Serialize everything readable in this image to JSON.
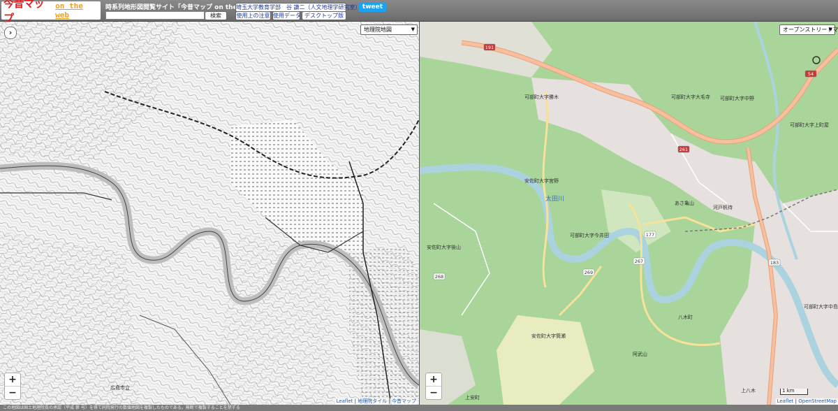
{
  "header": {
    "logo_main": "今昔マップ",
    "logo_sub": "on the web",
    "site_title": "時系列地形図閲覧サイト「今昔マップ on the web」",
    "search_placeholder": "",
    "search_button": "検索",
    "affiliation_link": "埼玉大学教育学部　谷 謙二（人文地理学研究室）",
    "usage_notes_link": "使用上の注意",
    "data_used_link": "使用データ",
    "desktop_link": "デスクトップ版",
    "tweet_label": "tweet"
  },
  "left_map": {
    "sidebar_toggle": "›",
    "map_select": "地理院地図",
    "zoom_in": "+",
    "zoom_out": "−",
    "attribution_leaflet": "Leaflet",
    "attribution_tiles": "地理院タイル",
    "attribution_site": "今昔マップ",
    "labels": [
      "広島市立"
    ]
  },
  "right_map": {
    "map_select": "オープンストリートマップ",
    "zoom_in": "+",
    "zoom_out": "−",
    "scale_label": "1 km",
    "attribution_leaflet": "Leaflet",
    "attribution_osm": "OpenStreetMap",
    "place_labels": [
      "可部町大字勝木",
      "可部町大字大毛寺",
      "可部町大字中野",
      "可部町大字上町屋",
      "安佐町大字宮野",
      "太田川",
      "可部町大字今井田",
      "安佐町大字後山",
      "安佐町大字筒瀬",
      "あさ亀山",
      "河戸帆待",
      "八木町",
      "可部町大字中島",
      "上安町",
      "阿武山",
      "上八木"
    ],
    "route_badges": [
      "191",
      "261",
      "54",
      "177",
      "269",
      "267",
      "183",
      "268"
    ],
    "colors": {
      "forest": "#a9d59a",
      "river": "#aad3df",
      "primary_road": "#f2a87c",
      "secondary_road": "#f7e29a",
      "urban": "#e6e1de"
    }
  },
  "footer_text": "この地図は国土地理院長の承認（平成 第 号）を得て同院発行の数値地図を複製したものである。無断で複製することを禁ずる"
}
